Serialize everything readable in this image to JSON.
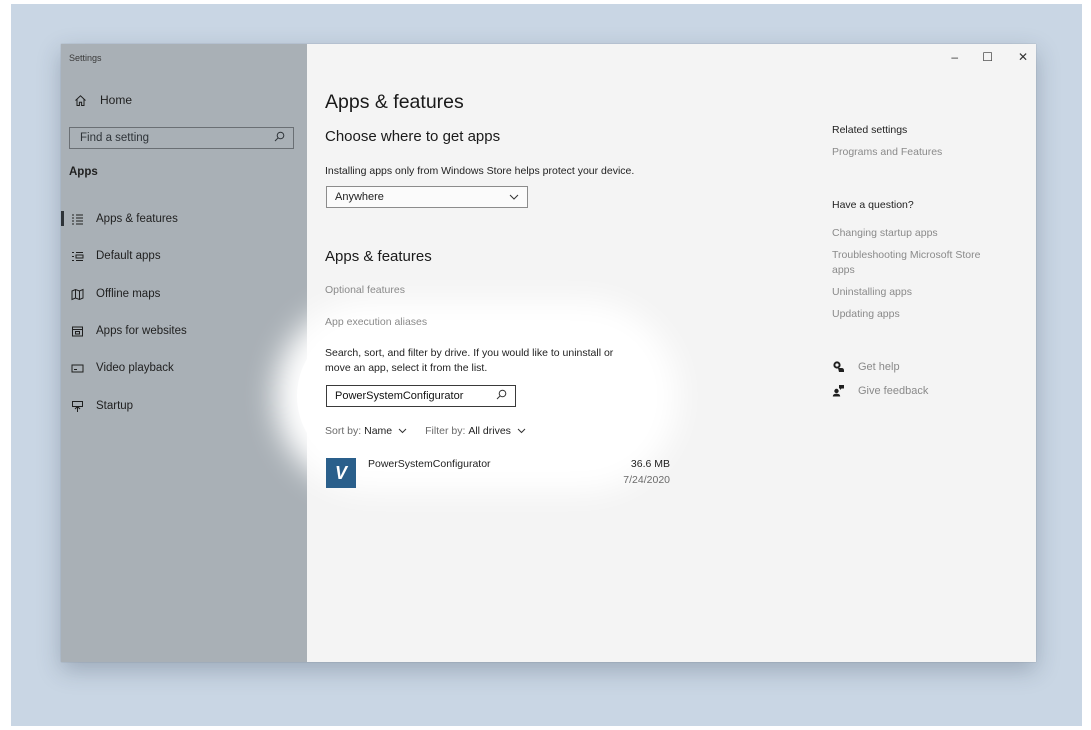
{
  "window": {
    "title": "Settings",
    "controls": {
      "minimize": "–",
      "maximize": "☐",
      "close": "✕"
    }
  },
  "sidebar": {
    "home_label": "Home",
    "search_placeholder": "Find a setting",
    "section": "Apps",
    "items": [
      {
        "label": "Apps & features",
        "icon": "apps-features-icon",
        "selected": true
      },
      {
        "label": "Default apps",
        "icon": "default-apps-icon",
        "selected": false
      },
      {
        "label": "Offline maps",
        "icon": "offline-maps-icon",
        "selected": false
      },
      {
        "label": "Apps for websites",
        "icon": "apps-for-websites-icon",
        "selected": false
      },
      {
        "label": "Video playback",
        "icon": "video-playback-icon",
        "selected": false
      },
      {
        "label": "Startup",
        "icon": "startup-icon",
        "selected": false
      }
    ]
  },
  "main": {
    "title": "Apps & features",
    "choose": {
      "heading": "Choose where to get apps",
      "description": "Installing apps only from Windows Store helps protect your device.",
      "dropdown_value": "Anywhere"
    },
    "features": {
      "heading": "Apps & features",
      "optional_link": "Optional features",
      "aliases_link": "App execution aliases",
      "instructions_line1": "Search, sort, and filter by drive. If you would like to uninstall or",
      "instructions_line2": "move an app, select it from the list.",
      "search_value": "PowerSystemConfigurator",
      "sort_label": "Sort by:",
      "sort_value": "Name",
      "filter_label": "Filter by:",
      "filter_value": "All drives"
    },
    "apps": [
      {
        "name": "PowerSystemConfigurator",
        "size": "36.6 MB",
        "date": "7/24/2020",
        "icon_letter": "V"
      }
    ]
  },
  "related": {
    "heading": "Related settings",
    "programs_link": "Programs and Features",
    "question_heading": "Have a question?",
    "links": [
      "Changing startup apps",
      "Troubleshooting Microsoft Store",
      "apps",
      "Uninstalling apps",
      "Updating apps"
    ],
    "get_help": "Get help",
    "give_feedback": "Give feedback"
  },
  "colors": {
    "sidebar_bg": "#a9b0b6",
    "content_bg": "#f4f4f4",
    "app_icon_bg": "#2a5f8b",
    "link_gray": "#8a8a8a"
  }
}
